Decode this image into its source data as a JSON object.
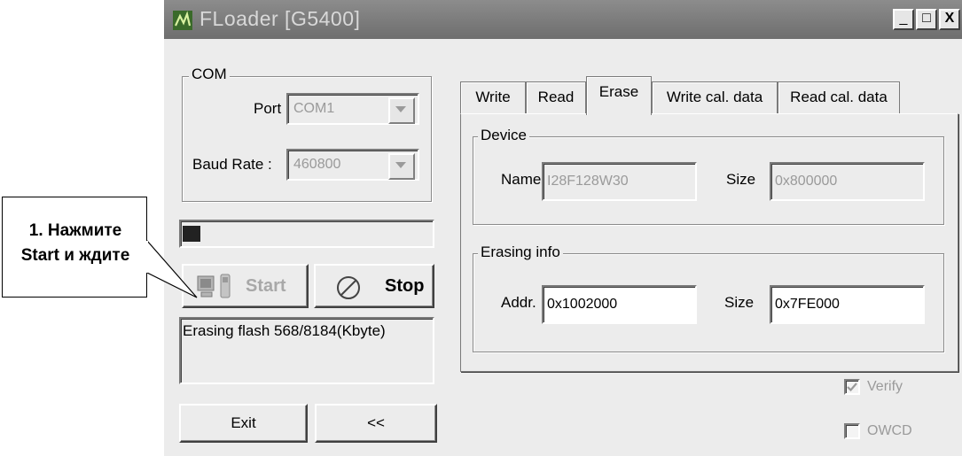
{
  "window": {
    "title": "FLoader [G5400]",
    "minimize_glyph": "_",
    "maximize_glyph": "□",
    "close_glyph": "X"
  },
  "com": {
    "legend": "COM",
    "port_label": "Port :",
    "port_value": "COM1",
    "baud_label": "Baud Rate :",
    "baud_value": "460800"
  },
  "progress": {
    "value": 0.07
  },
  "buttons": {
    "start": "Start",
    "stop": "Stop",
    "exit": "Exit",
    "back": "<<"
  },
  "status": {
    "text": "Erasing flash 568/8184(Kbyte)"
  },
  "tabs": [
    {
      "label": "Write",
      "active": false
    },
    {
      "label": "Read",
      "active": false
    },
    {
      "label": "Erase",
      "active": true
    },
    {
      "label": "Write cal. data",
      "active": false
    },
    {
      "label": "Read cal. data",
      "active": false
    }
  ],
  "device": {
    "legend": "Device",
    "name_label": "Name",
    "name_value": "I28F128W30",
    "size_label": "Size",
    "size_value": "0x800000"
  },
  "erasing": {
    "legend": "Erasing info",
    "addr_label": "Addr.",
    "addr_value": "0x1002000",
    "size_label": "Size",
    "size_value": "0x7FE000"
  },
  "options": {
    "verify_label": "Verify",
    "verify_checked": true,
    "owcd_label": "OWCD",
    "owcd_checked": false
  },
  "callout": {
    "line1": "1. Нажмите",
    "line2": "Start и ждите"
  },
  "icons": [
    "floader-app-icon",
    "phone-pc-icon",
    "stop-circle-icon",
    "check-icon"
  ]
}
